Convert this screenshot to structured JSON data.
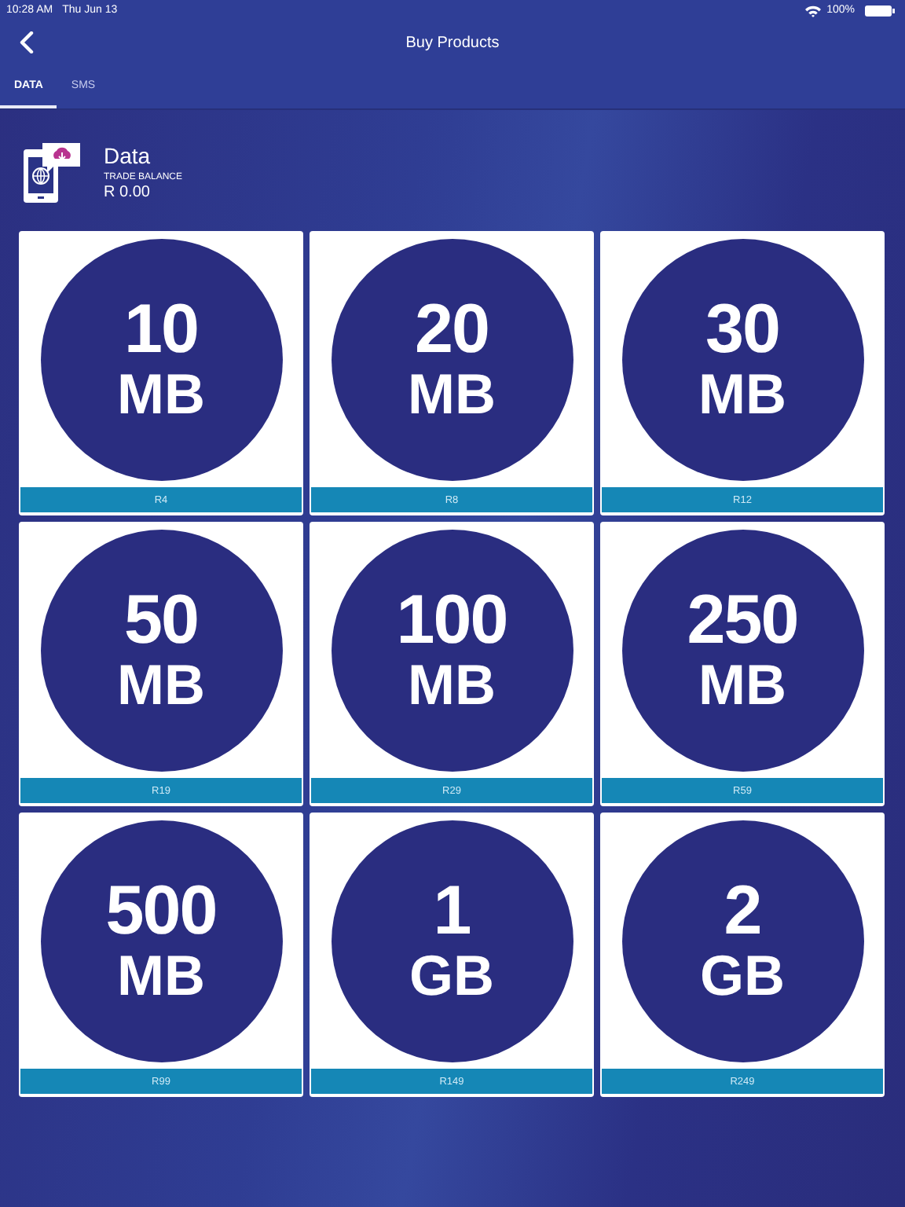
{
  "status_bar": {
    "time": "10:28 AM",
    "date": "Thu Jun 13",
    "battery": "100%"
  },
  "nav": {
    "title": "Buy Products"
  },
  "tabs": [
    {
      "label": "DATA",
      "selected": true
    },
    {
      "label": "SMS",
      "selected": false
    }
  ],
  "header": {
    "title": "Data",
    "balance_label": "TRADE BALANCE",
    "balance": "R 0.00"
  },
  "products": [
    {
      "amount": "10",
      "unit": "MB",
      "price": "R4"
    },
    {
      "amount": "20",
      "unit": "MB",
      "price": "R8"
    },
    {
      "amount": "30",
      "unit": "MB",
      "price": "R12"
    },
    {
      "amount": "50",
      "unit": "MB",
      "price": "R19"
    },
    {
      "amount": "100",
      "unit": "MB",
      "price": "R29"
    },
    {
      "amount": "250",
      "unit": "MB",
      "price": "R59"
    },
    {
      "amount": "500",
      "unit": "MB",
      "price": "R99"
    },
    {
      "amount": "1",
      "unit": "GB",
      "price": "R149"
    },
    {
      "amount": "2",
      "unit": "GB",
      "price": "R249"
    }
  ]
}
